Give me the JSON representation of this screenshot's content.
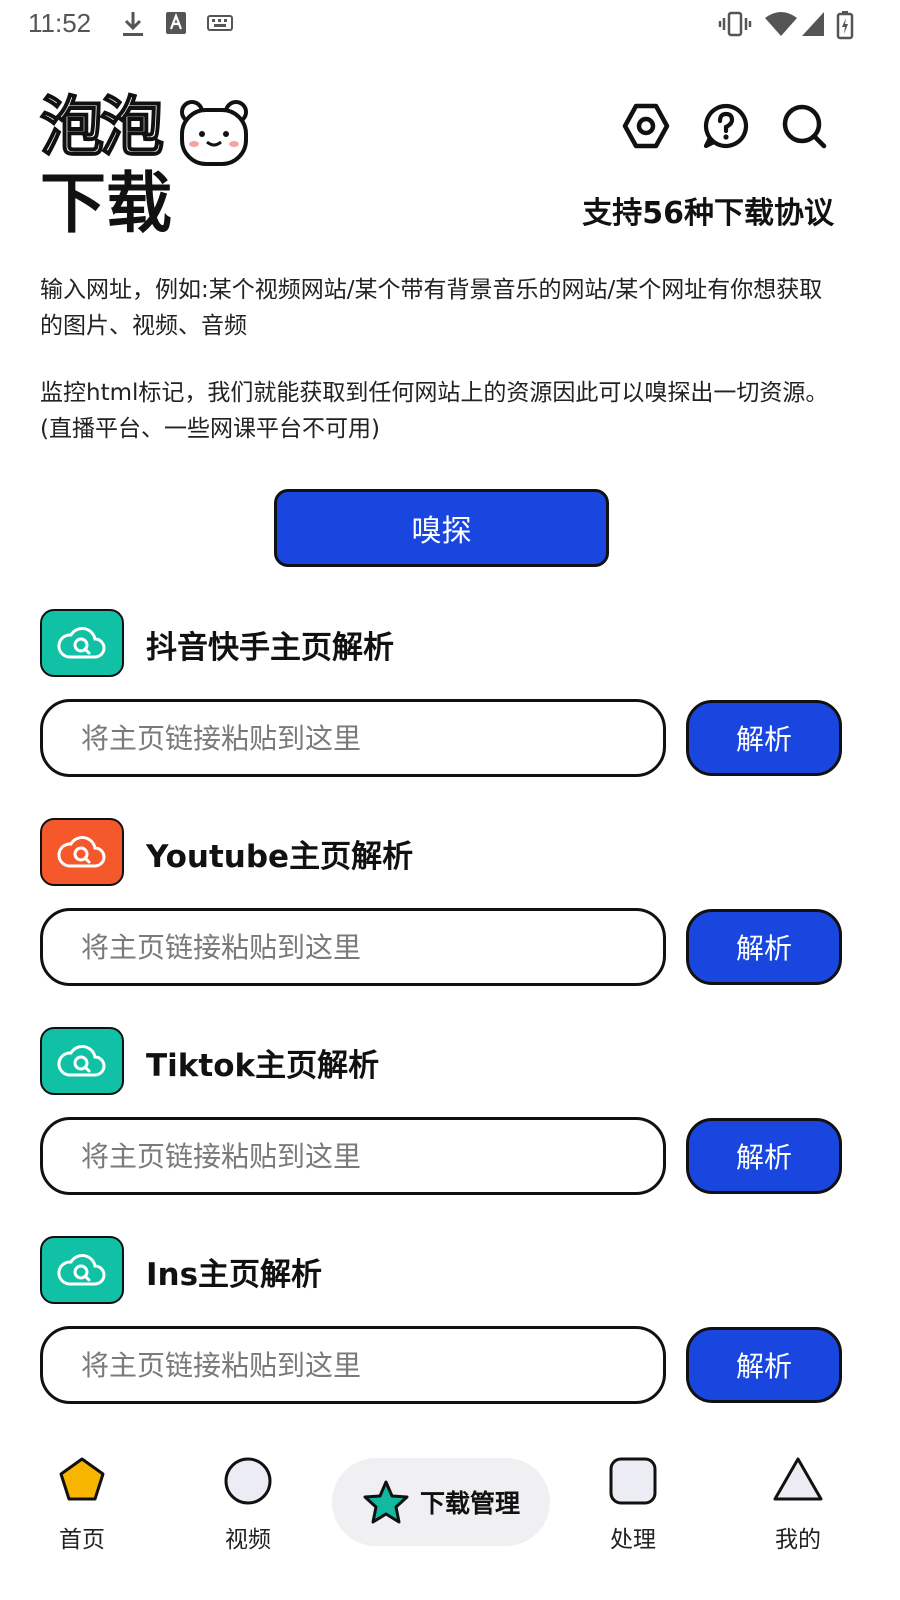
{
  "status_bar": {
    "time": "11:52"
  },
  "header": {
    "logo_line1": "泡泡",
    "logo_line2": "下载",
    "protocols": "支持56种下载协议"
  },
  "intro": {
    "line1": "输入网址，例如:某个视频网站/某个带有背景音乐的网站/某个网址有你想获取的图片、视频、音频",
    "line2": "监控html标记，我们就能获取到任何网站上的资源因此可以嗅探出一切资源。(直播平台、一些网课平台不可用)"
  },
  "sniff_button": "嗅探",
  "sections": [
    {
      "title": "抖音快手主页解析",
      "placeholder": "将主页链接粘贴到这里",
      "button": "解析",
      "icon_color": "#10c1a6"
    },
    {
      "title": "Youtube主页解析",
      "placeholder": "将主页链接粘贴到这里",
      "button": "解析",
      "icon_color": "#f4582b"
    },
    {
      "title": "Tiktok主页解析",
      "placeholder": "将主页链接粘贴到这里",
      "button": "解析",
      "icon_color": "#10c1a6"
    },
    {
      "title": "Ins主页解析",
      "placeholder": "将主页链接粘贴到这里",
      "button": "解析",
      "icon_color": "#10c1a6"
    }
  ],
  "nav": {
    "home": "首页",
    "video": "视频",
    "downloads": "下载管理",
    "process": "处理",
    "mine": "我的"
  },
  "colors": {
    "primary": "#1a46e0",
    "teal": "#10c1a6",
    "orange": "#f4582b",
    "star": "#12b8a0",
    "home_pentagon": "#f7b500"
  }
}
